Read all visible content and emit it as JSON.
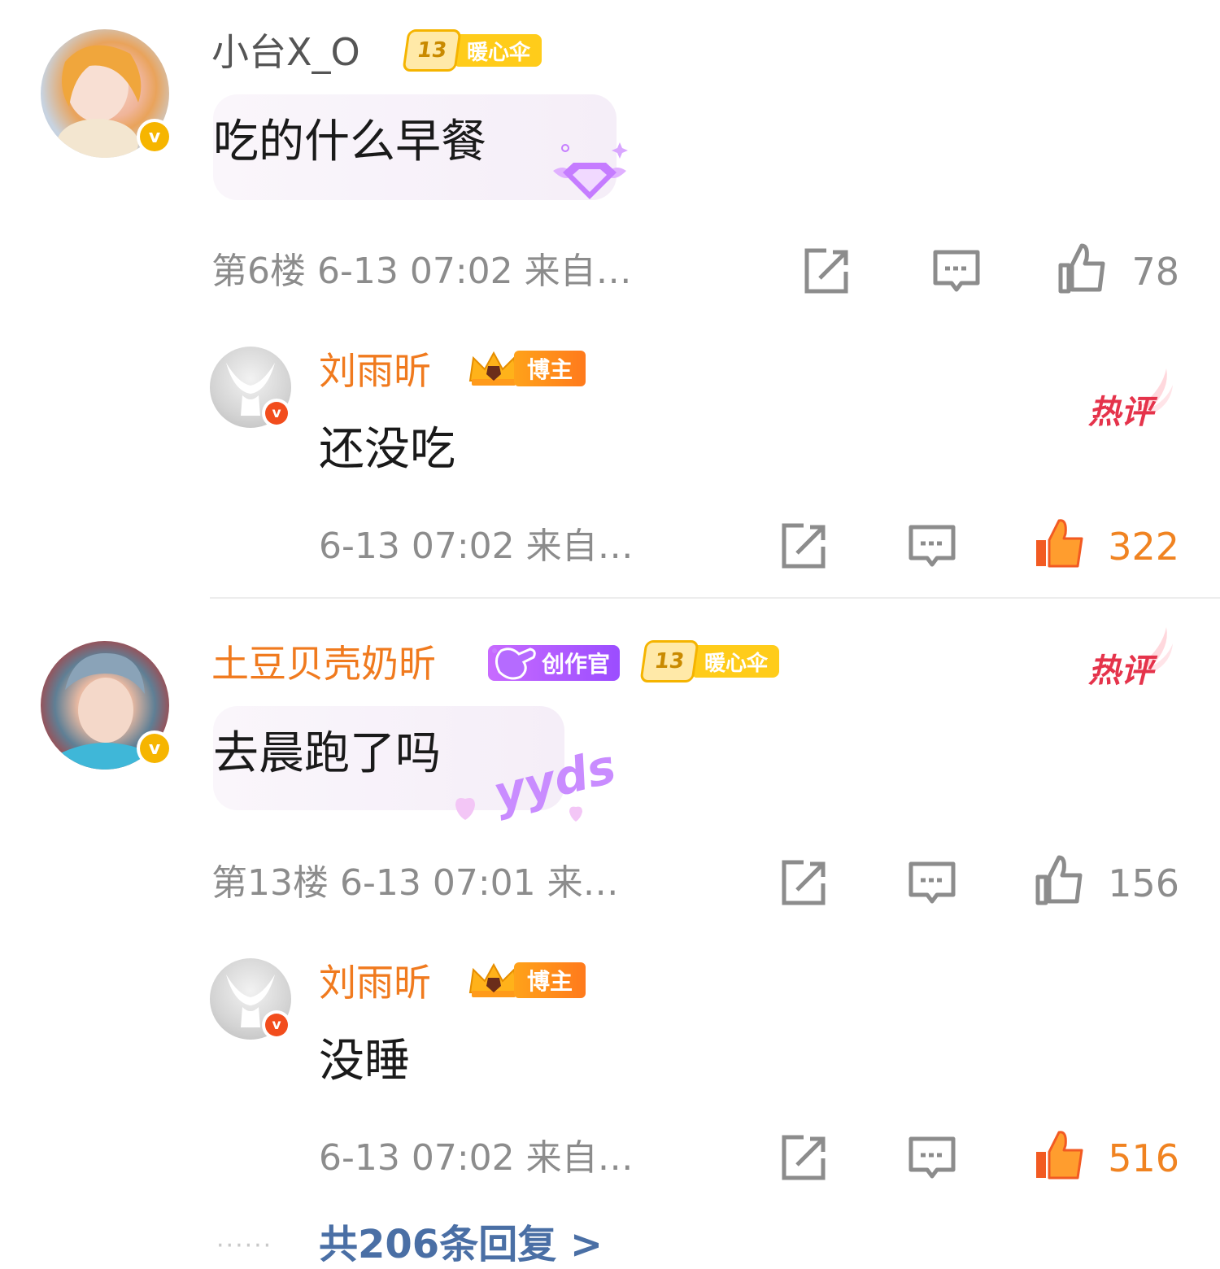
{
  "comments": [
    {
      "username": "小台X_O",
      "level": "13",
      "level_badge": "暖心伞",
      "text": "吃的什么早餐",
      "floor": "第6楼",
      "time": "6-13 07:02",
      "source": "来自…",
      "likes": "78",
      "reply": {
        "username": "刘雨昕",
        "badge": "博主",
        "hot_tag": "热评",
        "text": "还没吃",
        "time": "6-13 07:02",
        "source": "来自…",
        "likes": "322"
      }
    },
    {
      "username": "土豆贝壳奶昕",
      "creator_badge": "创作官",
      "level": "13",
      "level_badge": "暖心伞",
      "hot_tag": "热评",
      "text": "去晨跑了吗",
      "sticker": "yyds",
      "floor": "第13楼",
      "time": "6-13 07:01",
      "source": "来…",
      "likes": "156",
      "reply": {
        "username": "刘雨昕",
        "badge": "博主",
        "text": "没睡",
        "time": "6-13 07:02",
        "source": "来自…",
        "likes": "516"
      },
      "more_replies": "共206条回复 >"
    }
  ],
  "colors": {
    "accent_orange": "#f07a1e",
    "link_blue": "#4a6fa5",
    "hot_red": "#e5334b",
    "meta_gray": "#8c8c8c"
  },
  "icons": [
    "verified-icon",
    "share-icon",
    "comment-icon",
    "like-icon",
    "like-filled-icon",
    "chevron-right-icon"
  ]
}
